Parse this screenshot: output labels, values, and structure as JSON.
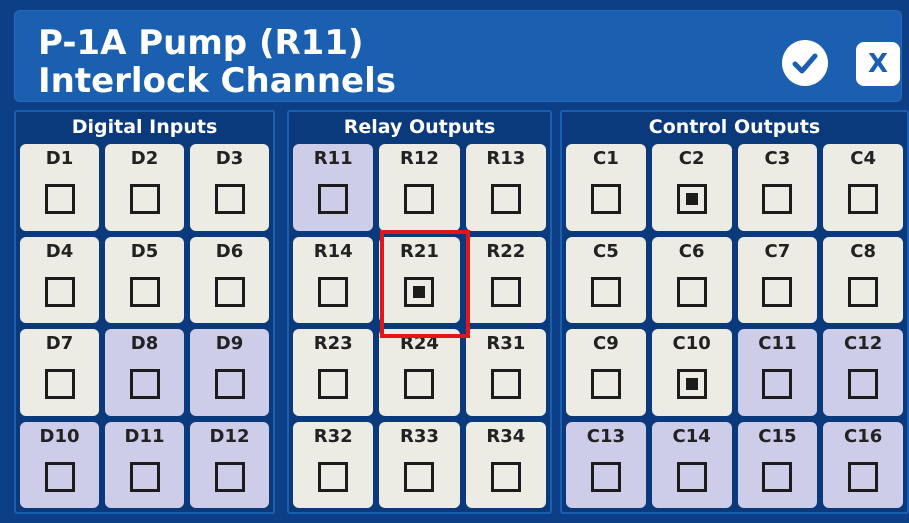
{
  "header": {
    "title_line1": "P-1A Pump (R11)",
    "title_line2": "Interlock Channels",
    "ok_icon": "check-icon",
    "close_label": "X"
  },
  "panels": [
    {
      "id": "digital",
      "title": "Digital Inputs",
      "channels": [
        {
          "label": "D1",
          "checked": false,
          "shade": "light"
        },
        {
          "label": "D2",
          "checked": false,
          "shade": "light"
        },
        {
          "label": "D3",
          "checked": false,
          "shade": "light"
        },
        {
          "label": "D4",
          "checked": false,
          "shade": "light"
        },
        {
          "label": "D5",
          "checked": false,
          "shade": "light"
        },
        {
          "label": "D6",
          "checked": false,
          "shade": "light"
        },
        {
          "label": "D7",
          "checked": false,
          "shade": "light"
        },
        {
          "label": "D8",
          "checked": false,
          "shade": "lavender"
        },
        {
          "label": "D9",
          "checked": false,
          "shade": "lavender"
        },
        {
          "label": "D10",
          "checked": false,
          "shade": "lavender"
        },
        {
          "label": "D11",
          "checked": false,
          "shade": "lavender"
        },
        {
          "label": "D12",
          "checked": false,
          "shade": "lavender"
        }
      ]
    },
    {
      "id": "relay",
      "title": "Relay Outputs",
      "channels": [
        {
          "label": "R11",
          "checked": false,
          "shade": "lavender"
        },
        {
          "label": "R12",
          "checked": false,
          "shade": "light"
        },
        {
          "label": "R13",
          "checked": false,
          "shade": "light"
        },
        {
          "label": "R14",
          "checked": false,
          "shade": "light"
        },
        {
          "label": "R21",
          "checked": true,
          "shade": "light"
        },
        {
          "label": "R22",
          "checked": false,
          "shade": "light"
        },
        {
          "label": "R23",
          "checked": false,
          "shade": "light"
        },
        {
          "label": "R24",
          "checked": false,
          "shade": "light"
        },
        {
          "label": "R31",
          "checked": false,
          "shade": "light"
        },
        {
          "label": "R32",
          "checked": false,
          "shade": "light"
        },
        {
          "label": "R33",
          "checked": false,
          "shade": "light"
        },
        {
          "label": "R34",
          "checked": false,
          "shade": "light"
        }
      ]
    },
    {
      "id": "control",
      "title": "Control Outputs",
      "channels": [
        {
          "label": "C1",
          "checked": false,
          "shade": "light"
        },
        {
          "label": "C2",
          "checked": true,
          "shade": "light"
        },
        {
          "label": "C3",
          "checked": false,
          "shade": "light"
        },
        {
          "label": "C4",
          "checked": false,
          "shade": "light"
        },
        {
          "label": "C5",
          "checked": false,
          "shade": "light"
        },
        {
          "label": "C6",
          "checked": false,
          "shade": "light"
        },
        {
          "label": "C7",
          "checked": false,
          "shade": "light"
        },
        {
          "label": "C8",
          "checked": false,
          "shade": "light"
        },
        {
          "label": "C9",
          "checked": false,
          "shade": "light"
        },
        {
          "label": "C10",
          "checked": true,
          "shade": "light"
        },
        {
          "label": "C11",
          "checked": false,
          "shade": "lavender"
        },
        {
          "label": "C12",
          "checked": false,
          "shade": "lavender"
        },
        {
          "label": "C13",
          "checked": false,
          "shade": "lavender"
        },
        {
          "label": "C14",
          "checked": false,
          "shade": "lavender"
        },
        {
          "label": "C15",
          "checked": false,
          "shade": "lavender"
        },
        {
          "label": "C16",
          "checked": false,
          "shade": "lavender"
        }
      ]
    }
  ],
  "colors": {
    "background": "#0d3f86",
    "header": "#1a5fb0",
    "cell_light": "#ecece4",
    "cell_lavender": "#cdcdea",
    "highlight": "#e0161b"
  }
}
